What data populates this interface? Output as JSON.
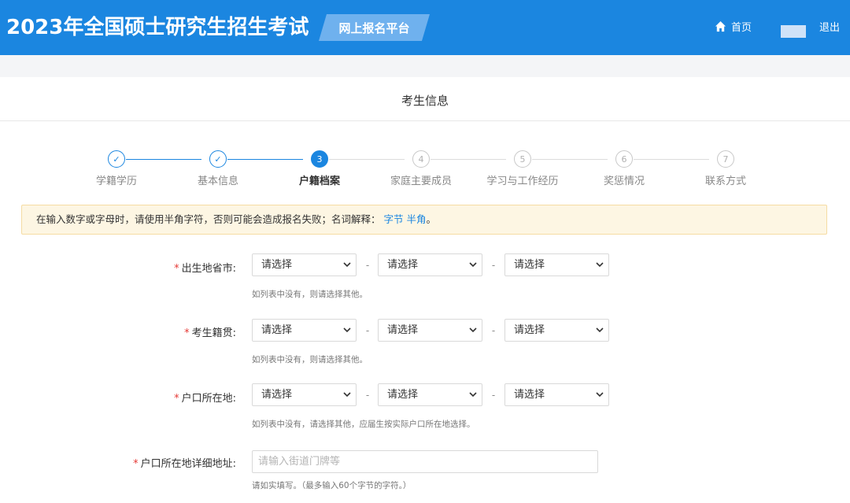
{
  "header": {
    "title": "2023年全国硕士研究生招生考试",
    "platform": "网上报名平台",
    "home": "首页",
    "logout": "退出"
  },
  "panel": {
    "title": "考生信息"
  },
  "steps": [
    {
      "index": "✓",
      "label": "学籍学历",
      "state": "done"
    },
    {
      "index": "✓",
      "label": "基本信息",
      "state": "done"
    },
    {
      "index": "3",
      "label": "户籍档案",
      "state": "active"
    },
    {
      "index": "4",
      "label": "家庭主要成员",
      "state": "todo"
    },
    {
      "index": "5",
      "label": "学习与工作经历",
      "state": "todo"
    },
    {
      "index": "6",
      "label": "奖惩情况",
      "state": "todo"
    },
    {
      "index": "7",
      "label": "联系方式",
      "state": "todo"
    }
  ],
  "notice": {
    "text": "在输入数字或字母时，请使用半角字符，否则可能会造成报名失败；名词解释：",
    "link1": "字节",
    "link2": "半角",
    "end": "。"
  },
  "form": {
    "required_mark": "*",
    "select_placeholder": "请选择",
    "dash": "-",
    "birthplace": {
      "label": "出生地省市:",
      "hint": "如列表中没有，则请选择其他。"
    },
    "native_place": {
      "label": "考生籍贯:",
      "hint": "如列表中没有，则请选择其他。"
    },
    "hukou": {
      "label": "户口所在地:",
      "hint": "如列表中没有，请选择其他，应届生按实际户口所在地选择。"
    },
    "hukou_address": {
      "label": "户口所在地详细地址:",
      "placeholder": "请输入街道门牌等",
      "value": "",
      "hint": "请如实填写。（最多输入60个字节的字符。）"
    }
  },
  "colors": {
    "primary": "#1b86e0",
    "notice_bg": "#fdf6e3",
    "required": "#e53935"
  }
}
